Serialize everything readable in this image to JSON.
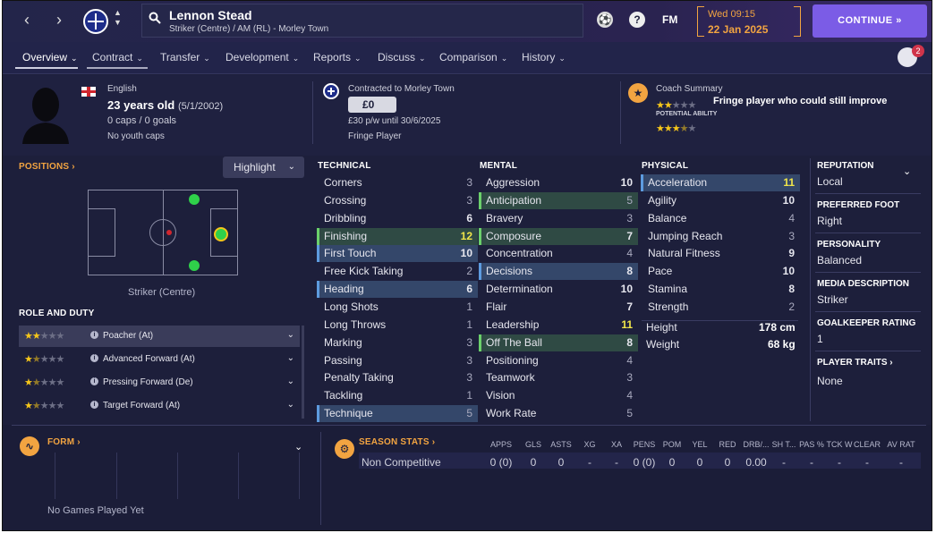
{
  "topbar": {
    "back_icon": "chevron-left-icon",
    "forward_icon": "chevron-right-icon",
    "player_name": "Lennon Stead",
    "player_sub": "Striker (Centre) / AM (RL) - Morley Town",
    "fm_label": "FM",
    "help_label": "?",
    "date_line1": "Wed 09:15",
    "date_line2": "22 Jan 2025",
    "continue_label": "CONTINUE",
    "notification_count": "2"
  },
  "tabs": [
    {
      "label": "Overview"
    },
    {
      "label": "Contract"
    },
    {
      "label": "Transfer"
    },
    {
      "label": "Development"
    },
    {
      "label": "Reports"
    },
    {
      "label": "Discuss"
    },
    {
      "label": "Comparison"
    },
    {
      "label": "History"
    }
  ],
  "header": {
    "nationality": "English",
    "age": "23 years old",
    "dob": "(5/1/2002)",
    "caps": "0 caps / 0 goals",
    "youth": "No youth caps",
    "contracted": "Contracted to Morley Town",
    "value": "£0",
    "wage": "£30 p/w until 30/6/2025",
    "status": "Fringe Player",
    "coach_title": "Coach Summary",
    "coach_text": "Fringe player who could still improve",
    "potential_label": "POTENTIAL ABILITY",
    "current_ability_stars": 2,
    "potential_ability_stars": 3.5
  },
  "positions": {
    "title": "POSITIONS",
    "highlight_label": "Highlight",
    "position_name": "Striker (Centre)"
  },
  "roles": {
    "title": "ROLE AND DUTY",
    "items": [
      {
        "name": "Poacher (At)",
        "stars": 2
      },
      {
        "name": "Advanced Forward (At)",
        "stars": 1.5
      },
      {
        "name": "Pressing Forward (De)",
        "stars": 1.5
      },
      {
        "name": "Target Forward (At)",
        "stars": 1.5
      }
    ]
  },
  "technical": {
    "title": "TECHNICAL",
    "items": [
      {
        "name": "Corners",
        "value": "3"
      },
      {
        "name": "Crossing",
        "value": "3"
      },
      {
        "name": "Dribbling",
        "value": "6"
      },
      {
        "name": "Finishing",
        "value": "12"
      },
      {
        "name": "First Touch",
        "value": "10"
      },
      {
        "name": "Free Kick Taking",
        "value": "2"
      },
      {
        "name": "Heading",
        "value": "6"
      },
      {
        "name": "Long Shots",
        "value": "1"
      },
      {
        "name": "Long Throws",
        "value": "1"
      },
      {
        "name": "Marking",
        "value": "3"
      },
      {
        "name": "Passing",
        "value": "3"
      },
      {
        "name": "Penalty Taking",
        "value": "3"
      },
      {
        "name": "Tackling",
        "value": "1"
      },
      {
        "name": "Technique",
        "value": "5"
      }
    ]
  },
  "mental": {
    "title": "MENTAL",
    "items": [
      {
        "name": "Aggression",
        "value": "10"
      },
      {
        "name": "Anticipation",
        "value": "5"
      },
      {
        "name": "Bravery",
        "value": "3"
      },
      {
        "name": "Composure",
        "value": "7"
      },
      {
        "name": "Concentration",
        "value": "4"
      },
      {
        "name": "Decisions",
        "value": "8"
      },
      {
        "name": "Determination",
        "value": "10"
      },
      {
        "name": "Flair",
        "value": "7"
      },
      {
        "name": "Leadership",
        "value": "11"
      },
      {
        "name": "Off The Ball",
        "value": "8"
      },
      {
        "name": "Positioning",
        "value": "4"
      },
      {
        "name": "Teamwork",
        "value": "3"
      },
      {
        "name": "Vision",
        "value": "4"
      },
      {
        "name": "Work Rate",
        "value": "5"
      }
    ]
  },
  "physical": {
    "title": "PHYSICAL",
    "items": [
      {
        "name": "Acceleration",
        "value": "11"
      },
      {
        "name": "Agility",
        "value": "10"
      },
      {
        "name": "Balance",
        "value": "4"
      },
      {
        "name": "Jumping Reach",
        "value": "3"
      },
      {
        "name": "Natural Fitness",
        "value": "9"
      },
      {
        "name": "Pace",
        "value": "10"
      },
      {
        "name": "Stamina",
        "value": "8"
      },
      {
        "name": "Strength",
        "value": "2"
      }
    ],
    "height_label": "Height",
    "height_value": "178 cm",
    "weight_label": "Weight",
    "weight_value": "68 kg"
  },
  "info": {
    "reputation_label": "REPUTATION",
    "reputation_value": "Local",
    "foot_label": "PREFERRED FOOT",
    "foot_value": "Right",
    "personality_label": "PERSONALITY",
    "personality_value": "Balanced",
    "media_label": "MEDIA DESCRIPTION",
    "media_value": "Striker",
    "gk_label": "GOALKEEPER RATING",
    "gk_value": "1",
    "traits_label": "PLAYER TRAITS",
    "traits_value": "None"
  },
  "form": {
    "title": "FORM",
    "empty_text": "No Games Played Yet"
  },
  "season_stats": {
    "title": "SEASON STATS",
    "headers": [
      "APPS",
      "GLS",
      "ASTS",
      "XG",
      "XA",
      "PENS",
      "POM",
      "YEL",
      "RED",
      "DRB/...",
      "SH T...",
      "PAS %",
      "TCK W",
      "CLEAR",
      "AV RAT"
    ],
    "row_label": "Non Competitive",
    "row_values": [
      "0 (0)",
      "0",
      "0",
      "-",
      "-",
      "0 (0)",
      "0",
      "0",
      "0",
      "0.00",
      "-",
      "-",
      "-",
      "-",
      "-"
    ]
  },
  "colors": {
    "accent": "#7b5ce6",
    "orange": "#f2a441",
    "background": "#1d1f3b"
  }
}
